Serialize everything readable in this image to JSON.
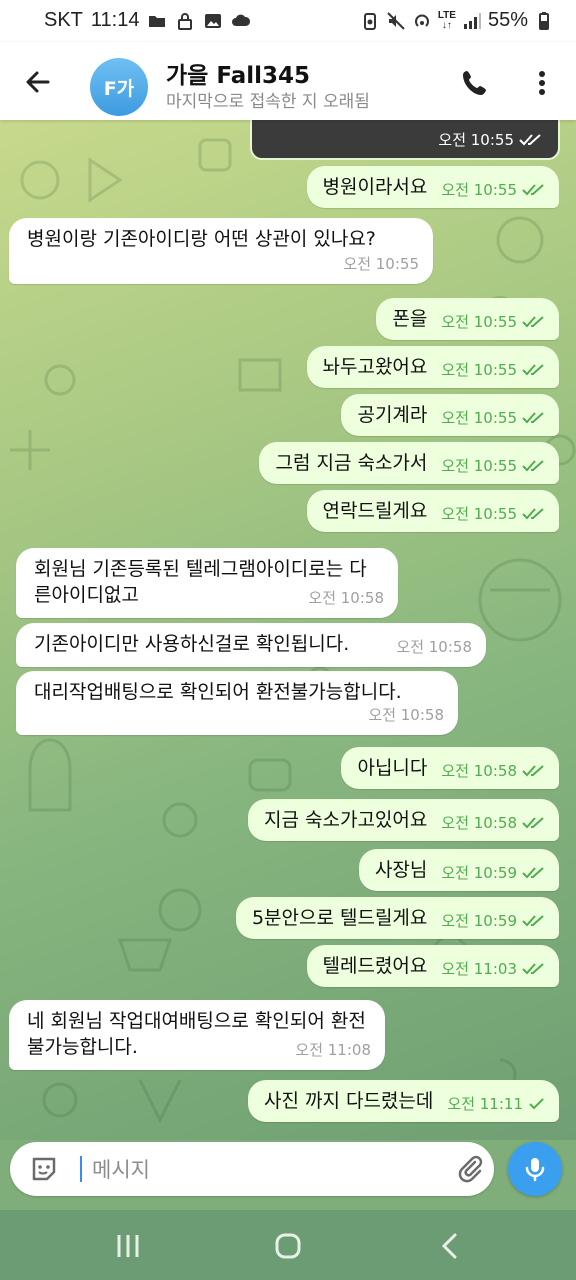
{
  "status_bar": {
    "carrier": "SKT",
    "time": "11:14",
    "battery": "55%"
  },
  "header": {
    "avatar_initials": "F가",
    "title": "가을 Fall345",
    "subtitle": "마지막으로 접속한 지 오래됨"
  },
  "messages": [
    {
      "dir": "out",
      "text": "병원이라서요",
      "time": "오전 10:55",
      "status": "read"
    },
    {
      "dir": "in",
      "text": "병원이랑 기존아이디랑 어떤 상관이 있나요?",
      "time": "오전 10:55"
    },
    {
      "dir": "out",
      "text": "폰을",
      "time": "오전 10:55",
      "status": "read"
    },
    {
      "dir": "out",
      "text": "놔두고왔어요",
      "time": "오전 10:55",
      "status": "read"
    },
    {
      "dir": "out",
      "text": "공기계라",
      "time": "오전 10:55",
      "status": "read"
    },
    {
      "dir": "out",
      "text": "그럼 지금 숙소가서",
      "time": "오전 10:55",
      "status": "read"
    },
    {
      "dir": "out",
      "text": "연락드릴게요",
      "time": "오전 10:55",
      "status": "read"
    },
    {
      "dir": "in",
      "text": "회원님 기존등록된 텔레그램아이디로는 다른아이디없고",
      "time": "오전 10:58"
    },
    {
      "dir": "in",
      "text": "기존아이디만 사용하신걸로 확인됩니다.",
      "time": "오전 10:58"
    },
    {
      "dir": "in",
      "text": "대리작업배팅으로 확인되어 환전불가능합니다.",
      "time": "오전 10:58"
    },
    {
      "dir": "out",
      "text": "아닙니다",
      "time": "오전 10:58",
      "status": "read"
    },
    {
      "dir": "out",
      "text": "지금 숙소가고있어요",
      "time": "오전 10:58",
      "status": "read"
    },
    {
      "dir": "out",
      "text": "사장님",
      "time": "오전 10:59",
      "status": "read"
    },
    {
      "dir": "out",
      "text": "5분안으로 텔드릴게요",
      "time": "오전 10:59",
      "status": "read"
    },
    {
      "dir": "out",
      "text": "텔레드렸어요",
      "time": "오전 11:03",
      "status": "read"
    },
    {
      "dir": "in",
      "text": "네 회원님 작업대여배팅으로 확인되어 환전불가능합니다.",
      "time": "오전 11:08"
    },
    {
      "dir": "out",
      "text": "사진 까지 다드렸는데",
      "time": "오전 11:11",
      "status": "sent"
    }
  ],
  "photo_message": {
    "time": "오전 10:55"
  },
  "composer": {
    "placeholder": "메시지"
  },
  "icons": {
    "back": "arrow-left-icon",
    "call": "phone-icon",
    "more": "more-vertical-icon",
    "emoji": "sticker-icon",
    "attach": "paperclip-icon",
    "mic": "microphone-icon"
  },
  "colors": {
    "outgoing_bubble": "#eeffde",
    "incoming_bubble": "#ffffff",
    "check_green": "#4fae4e",
    "accent": "#3b9ff0"
  }
}
